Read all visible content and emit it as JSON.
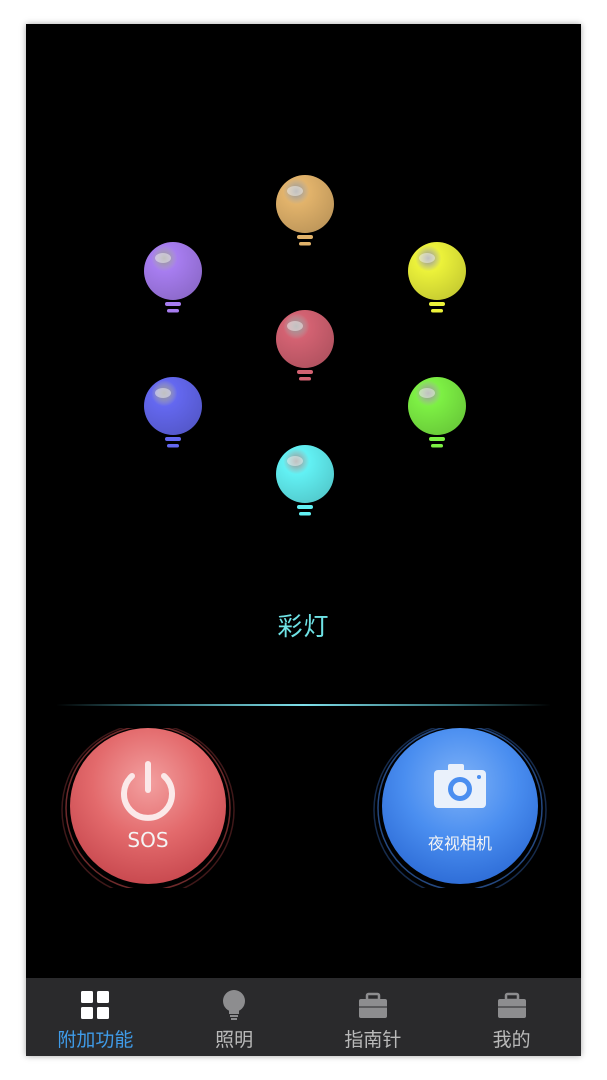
{
  "page": {
    "mode_title": "彩灯"
  },
  "bulbs": [
    {
      "name": "bulb-orange",
      "color": "#e2b36b"
    },
    {
      "name": "bulb-purple",
      "color": "#a77df0"
    },
    {
      "name": "bulb-yellow",
      "color": "#ecf23a"
    },
    {
      "name": "bulb-red",
      "color": "#d36272"
    },
    {
      "name": "bulb-blue",
      "color": "#6468f0"
    },
    {
      "name": "bulb-green",
      "color": "#7df044"
    },
    {
      "name": "bulb-cyan",
      "color": "#62f1f4"
    }
  ],
  "buttons": {
    "sos": {
      "label": "SOS",
      "icon": "power-icon",
      "color": "#e3646a"
    },
    "night_camera": {
      "label": "夜视相机",
      "icon": "camera-icon",
      "color": "#4a8ef0"
    }
  },
  "tabbar": {
    "items": [
      {
        "label": "附加功能",
        "icon": "grid-icon",
        "active": true
      },
      {
        "label": "照明",
        "icon": "lightbulb-icon",
        "active": false
      },
      {
        "label": "指南针",
        "icon": "briefcase-icon",
        "active": false
      },
      {
        "label": "我的",
        "icon": "briefcase-icon",
        "active": false
      }
    ],
    "active_color": "#3f9be8",
    "inactive_color": "#b9b9b9"
  }
}
